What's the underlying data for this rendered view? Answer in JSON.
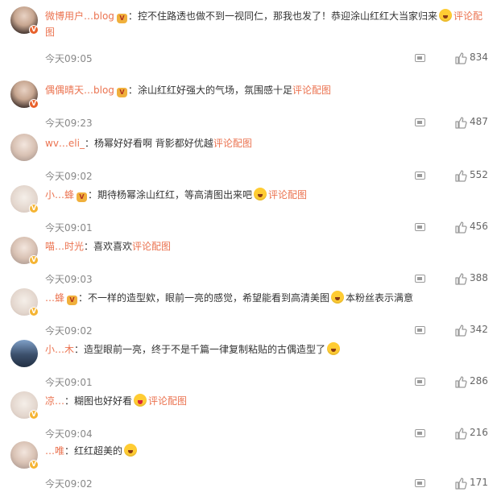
{
  "comments": [
    {
      "name": "微博用户…blog",
      "text": "控不住路透也做不到一视同仁，那我也发了！恭迎涂山红红大当家归来",
      "emoji": "smile",
      "link": "评论配图",
      "time": "今天09:05",
      "likes": "834",
      "crown": true,
      "badge": "red",
      "avatar": "dark"
    },
    {
      "name": "偶偶晴天…blog",
      "text": "涂山红红好强大的气场，氛围感十足",
      "emoji": "",
      "link": "评论配图",
      "time": "今天09:23",
      "likes": "487",
      "crown": true,
      "badge": "red",
      "avatar": "dark"
    },
    {
      "name": "wv…eli_",
      "text": "杨幂好好看啊 背影都好优越",
      "emoji": "",
      "link": "评论配图",
      "time": "今天09:02",
      "likes": "552",
      "crown": false,
      "badge": "",
      "avatar": "light"
    },
    {
      "name": "小…蜂",
      "text": "期待杨幂涂山红红，等高清图出来吧",
      "emoji": "wow",
      "link": "评论配图",
      "time": "今天09:01",
      "likes": "456",
      "crown": true,
      "badge": "gold",
      "avatar": "pale"
    },
    {
      "name": "喵…时光",
      "text": "喜欢喜欢",
      "emoji": "",
      "link": "评论配图",
      "time": "今天09:03",
      "likes": "388",
      "crown": false,
      "badge": "gold",
      "avatar": "light"
    },
    {
      "name": "…蜂",
      "text": "不一样的造型欸，眼前一亮的感觉，希望能看到高清美图",
      "emoji": "wow",
      "tail": "本粉丝表示满意",
      "link": "",
      "time": "今天09:02",
      "likes": "342",
      "crown": true,
      "badge": "gold",
      "avatar": "pale"
    },
    {
      "name": "小…木",
      "text": "造型眼前一亮，终于不是千篇一律复制粘贴的古偶造型了",
      "emoji": "smile",
      "link": "",
      "time": "今天09:01",
      "likes": "286",
      "crown": false,
      "badge": "",
      "avatar": "blue"
    },
    {
      "name": "凉…",
      "text": "糊图也好好看",
      "emoji": "heart",
      "link": "评论配图",
      "time": "今天09:04",
      "likes": "216",
      "crown": false,
      "badge": "gold",
      "avatar": "pale"
    },
    {
      "name": "…唯",
      "text": "红红超美的",
      "emoji": "wow",
      "link": "",
      "time": "今天09:02",
      "likes": "171",
      "crown": false,
      "badge": "gold",
      "avatar": "light"
    }
  ],
  "separator": "：",
  "badge_label": "V",
  "crown_label": "V",
  "colors": {
    "name": "#eb7350",
    "link": "#eb7350",
    "text": "#333333",
    "meta": "#888888"
  }
}
